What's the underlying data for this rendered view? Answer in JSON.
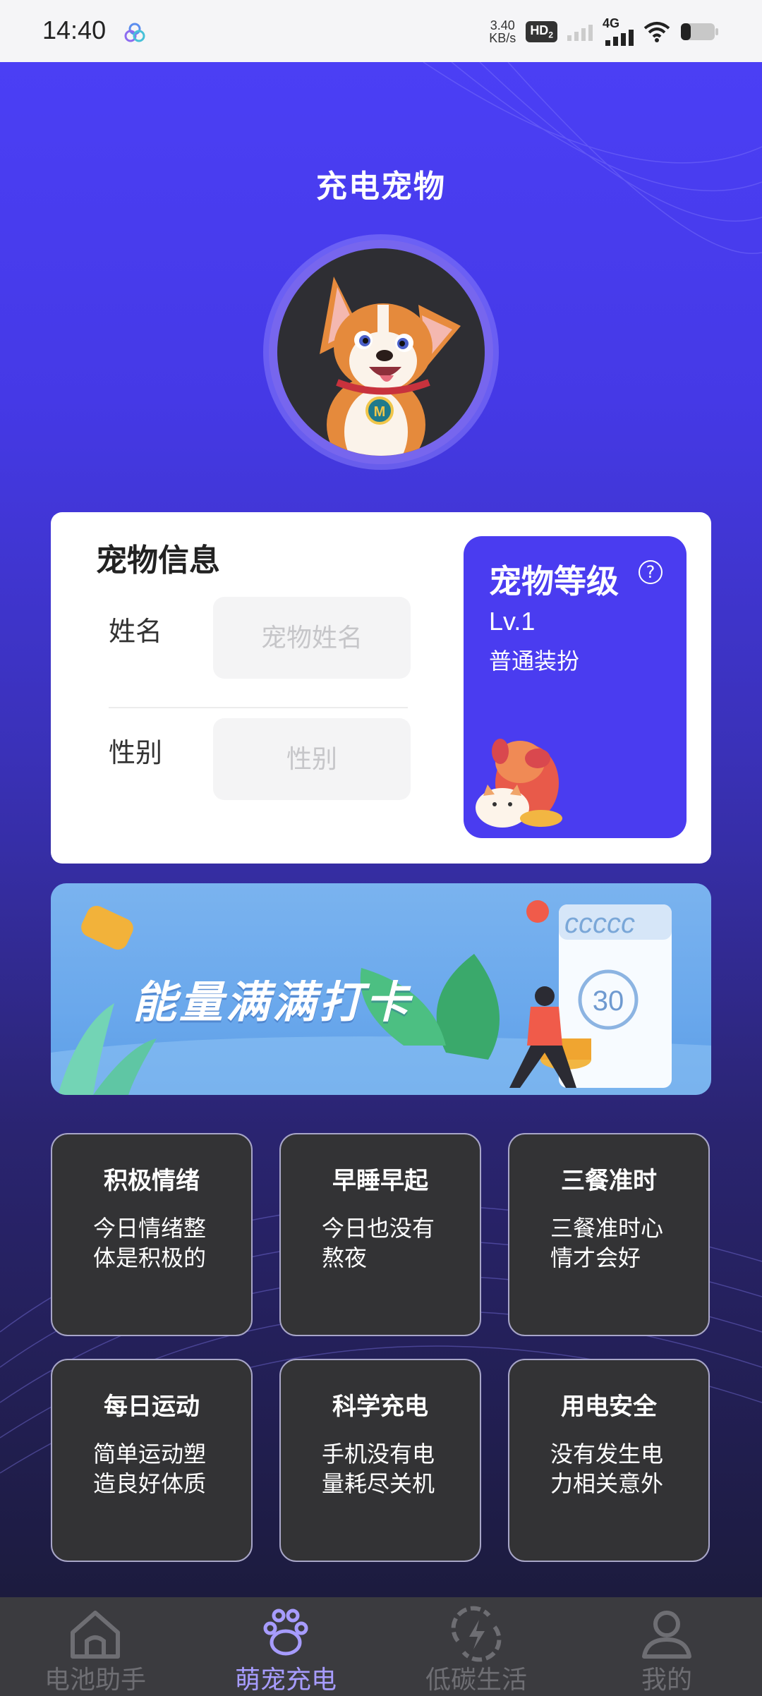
{
  "status_bar": {
    "time": "14:40",
    "net_speed_value": "3.40",
    "net_speed_unit": "KB/s",
    "hd_badge": "HD",
    "hd_sub": "2",
    "network_type": "4G"
  },
  "page": {
    "title": "充电宠物"
  },
  "pet_info": {
    "title": "宠物信息",
    "name_label": "姓名",
    "name_placeholder": "宠物姓名",
    "gender_label": "性别",
    "gender_placeholder": "性别"
  },
  "pet_level": {
    "title": "宠物等级",
    "help": "?",
    "level": "Lv.1",
    "outfit": "普通装扮"
  },
  "banner": {
    "text": "能量满满打卡",
    "calendar_text": "ccccc",
    "calendar_num": "30"
  },
  "tasks": [
    {
      "title": "积极情绪",
      "desc": "今日情绪整体是积极的"
    },
    {
      "title": "早睡早起",
      "desc": "今日也没有熬夜"
    },
    {
      "title": "三餐准时",
      "desc": "三餐准时心情才会好"
    },
    {
      "title": "每日运动",
      "desc": "简单运动塑造良好体质"
    },
    {
      "title": "科学充电",
      "desc": "手机没有电量耗尽关机"
    },
    {
      "title": "用电安全",
      "desc": "没有发生电力相关意外"
    }
  ],
  "bottom_nav": [
    {
      "label": "电池助手",
      "icon": "home-icon",
      "active": false
    },
    {
      "label": "萌宠充电",
      "icon": "paw-icon",
      "active": true
    },
    {
      "label": "低碳生活",
      "icon": "eco-energy-icon",
      "active": false
    },
    {
      "label": "我的",
      "icon": "user-icon",
      "active": false
    }
  ],
  "colors": {
    "primary": "#4a3cf0",
    "active_tab": "#a79cff",
    "task_bg": "#333335"
  }
}
